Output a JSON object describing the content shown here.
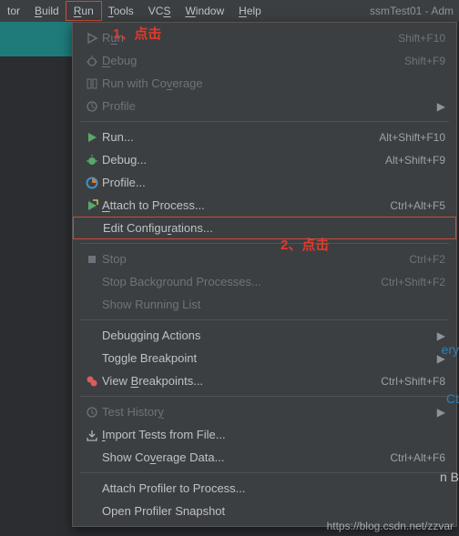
{
  "menubar": {
    "items": [
      {
        "label": "tor",
        "mn": ""
      },
      {
        "label": "Build",
        "mn": "B"
      },
      {
        "label": "Run",
        "mn": "R",
        "active": true
      },
      {
        "label": "Tools",
        "mn": "T"
      },
      {
        "label": "VCS",
        "mn": "S"
      },
      {
        "label": "Window",
        "mn": "W"
      },
      {
        "label": "Help",
        "mn": "H"
      }
    ],
    "title": "ssmTest01 - Adm"
  },
  "menu": {
    "groups": [
      [
        {
          "icon": "play-outline",
          "label": "Run",
          "mn": "u",
          "shortcut": "Shift+F10",
          "disabled": true
        },
        {
          "icon": "bug-outline",
          "label": "Debug",
          "mn": "D",
          "shortcut": "Shift+F9",
          "disabled": true
        },
        {
          "icon": "coverage",
          "label": "Run with Coverage",
          "mn": "v",
          "disabled": true
        },
        {
          "icon": "profile-outline",
          "label": "Profile",
          "mn": "",
          "disabled": true,
          "submenu": true
        }
      ],
      [
        {
          "icon": "play-green",
          "label": "Run...",
          "mn": "",
          "shortcut": "Alt+Shift+F10"
        },
        {
          "icon": "bug-green",
          "label": "Debug...",
          "mn": "",
          "shortcut": "Alt+Shift+F9"
        },
        {
          "icon": "profile-color",
          "label": "Profile...",
          "mn": ""
        },
        {
          "icon": "attach",
          "label": "Attach to Process...",
          "mn": "A",
          "shortcut": "Ctrl+Alt+F5"
        },
        {
          "icon": "",
          "label": "Edit Configurations...",
          "mn": "r",
          "highlight": true
        }
      ],
      [
        {
          "icon": "stop",
          "label": "Stop",
          "mn": "",
          "shortcut": "Ctrl+F2",
          "disabled": true
        },
        {
          "icon": "",
          "label": "Stop Background Processes...",
          "mn": "",
          "shortcut": "Ctrl+Shift+F2",
          "disabled": true
        },
        {
          "icon": "",
          "label": "Show Running List",
          "mn": "",
          "disabled": true
        }
      ],
      [
        {
          "icon": "",
          "label": "Debugging Actions",
          "mn": "",
          "submenu": true
        },
        {
          "icon": "",
          "label": "Toggle Breakpoint",
          "mn": "",
          "submenu": true
        },
        {
          "icon": "breakpoints",
          "label": "View Breakpoints...",
          "mn": "B",
          "shortcut": "Ctrl+Shift+F8"
        }
      ],
      [
        {
          "icon": "history",
          "label": "Test History",
          "mn": "y",
          "disabled": true,
          "submenu": true
        },
        {
          "icon": "import",
          "label": "Import Tests from File...",
          "mn": "I"
        },
        {
          "icon": "",
          "label": "Show Coverage Data...",
          "mn": "v",
          "shortcut": "Ctrl+Alt+F6"
        }
      ],
      [
        {
          "icon": "",
          "label": "Attach Profiler to Process...",
          "mn": ""
        },
        {
          "icon": "",
          "label": "Open Profiler Snapshot",
          "mn": ""
        }
      ]
    ]
  },
  "annotations": {
    "a1": "1、点击",
    "a2": "2、点击"
  },
  "edge": {
    "e1": "ery",
    "e2": "Ct",
    "e3": "n B"
  },
  "watermark": "https://blog.csdn.net/zzvar"
}
